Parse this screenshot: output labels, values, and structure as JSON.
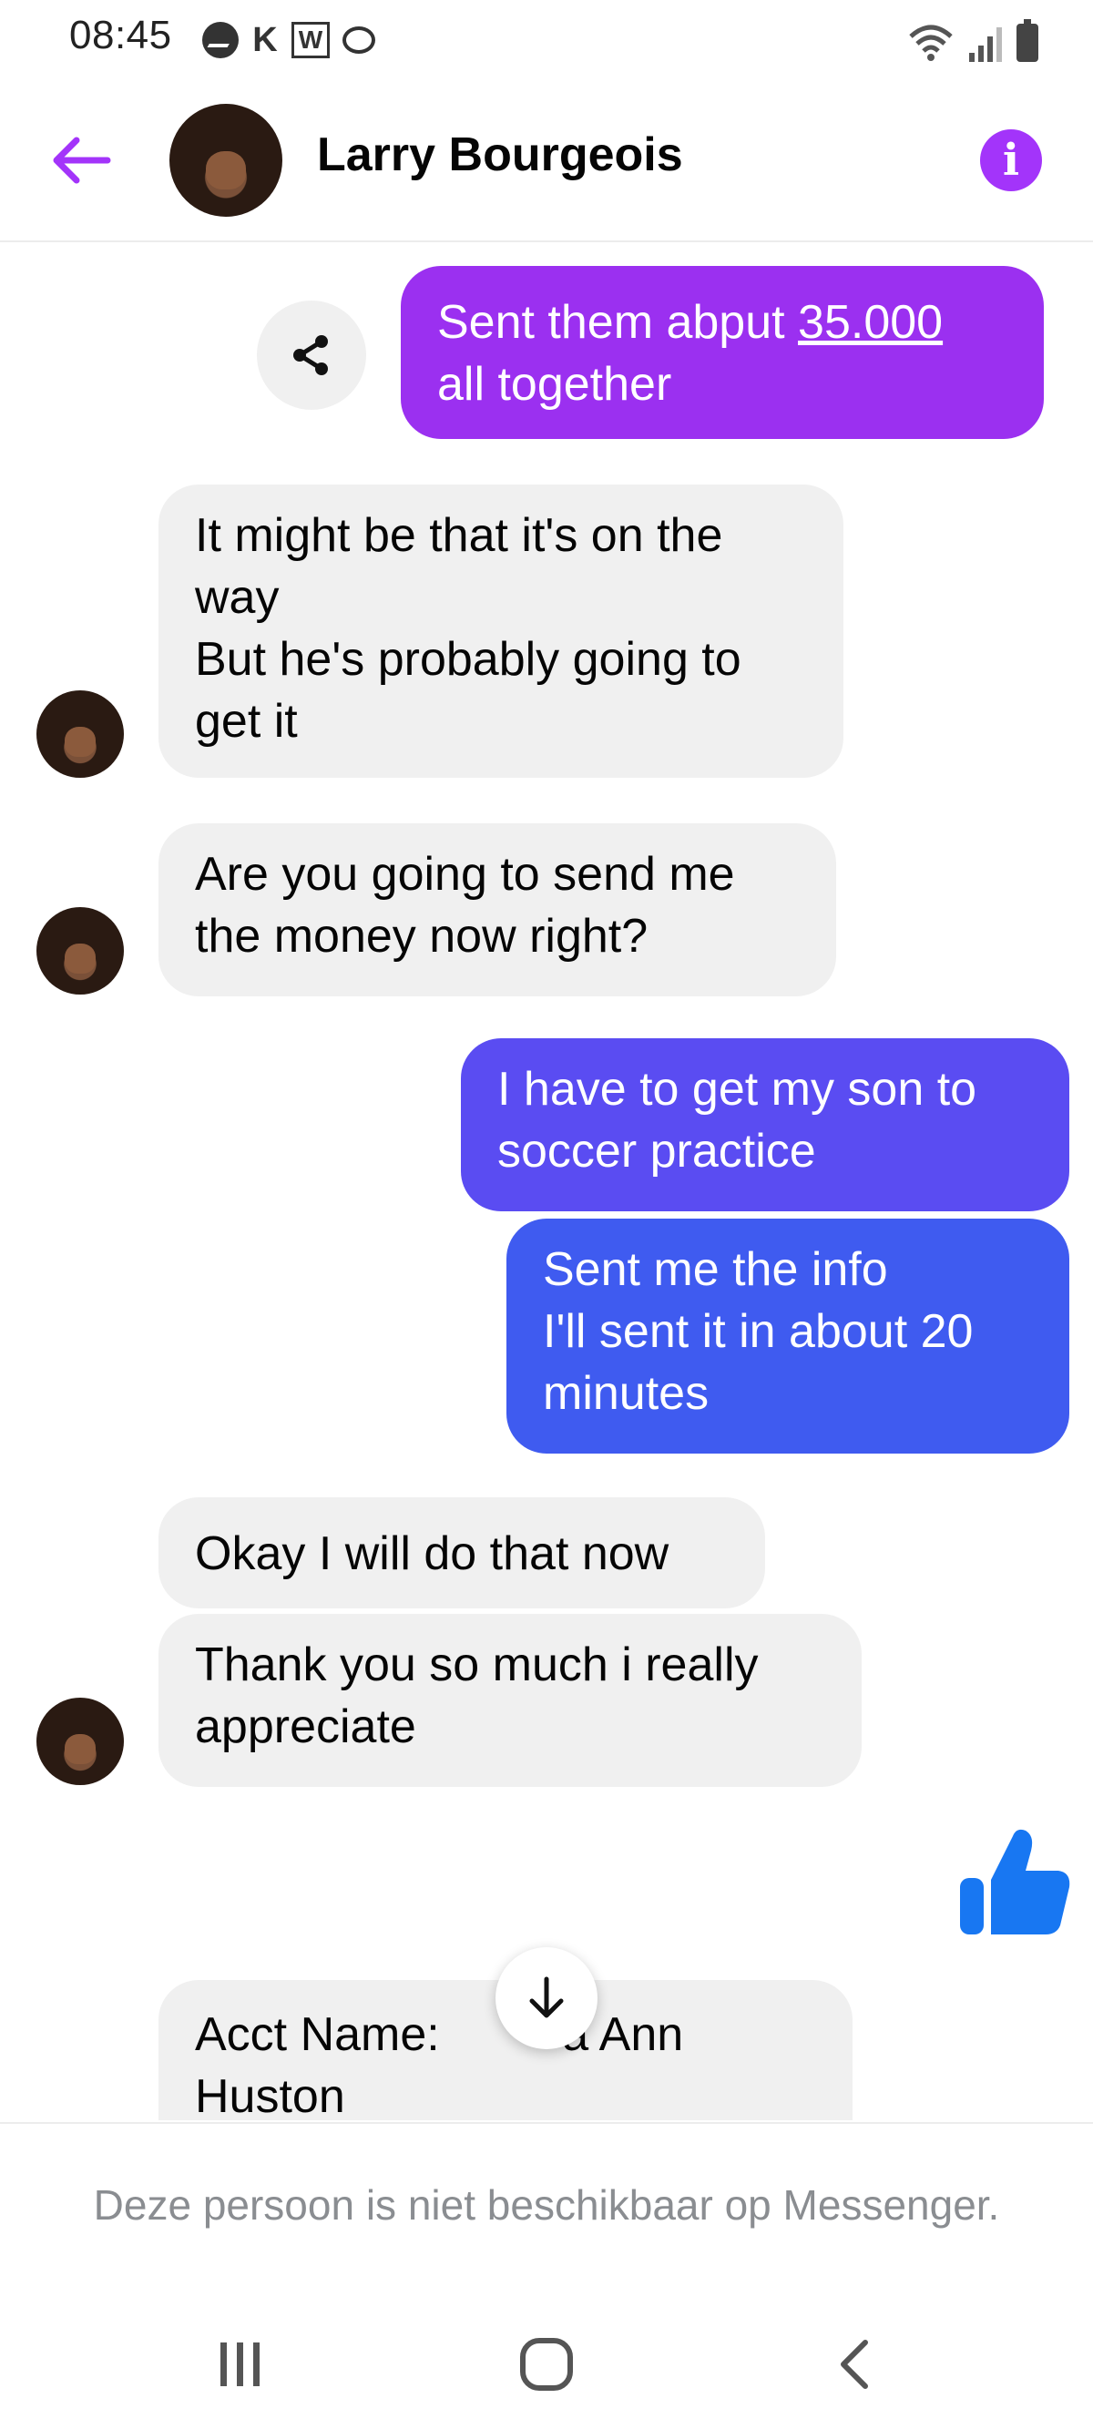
{
  "status_bar": {
    "time": "08:45",
    "notification_icons": [
      "messenger-icon",
      "k-icon",
      "w-icon",
      "chat-icon"
    ],
    "right_icons": [
      "wifi-icon",
      "signal-icon",
      "battery-icon"
    ],
    "k_label": "K",
    "w_label": "W"
  },
  "header": {
    "contact_name": "Larry Bourgeois",
    "info_label": "i",
    "accent_color": "#a334fa"
  },
  "messages": [
    {
      "id": "m1",
      "direction": "out",
      "text_prefix": "Sent them abput ",
      "text_link": "35.000",
      "text_suffix_line": "all together",
      "color": "#9b30f0"
    },
    {
      "id": "m2",
      "direction": "in",
      "lines": [
        "It might be that it's on the",
        "way",
        "But he's probably going to",
        "get it"
      ]
    },
    {
      "id": "m3",
      "direction": "in",
      "lines": [
        "Are you going to send me",
        "the money now right?"
      ]
    },
    {
      "id": "m4",
      "direction": "out",
      "lines": [
        "I have to get my son to",
        "soccer practice"
      ],
      "color": "#5a4cf2"
    },
    {
      "id": "m5",
      "direction": "out",
      "lines": [
        "Sent me the info",
        "I'll sent it in about 20",
        "minutes"
      ],
      "color": "#3f5bf0"
    },
    {
      "id": "m6",
      "direction": "in",
      "lines": [
        "Okay I will do that now"
      ]
    },
    {
      "id": "m7",
      "direction": "in",
      "lines": [
        "Thank you so much i really",
        "appreciate"
      ]
    },
    {
      "id": "m8",
      "direction": "in",
      "lines": [
        "Acct Name: ",
        "Huston"
      ],
      "line1_tail": "a Ann"
    }
  ],
  "like_color": "#1877f2",
  "footer": {
    "unavailable_text": "Deze persoon is niet beschikbaar op Messenger."
  },
  "navbar": {
    "buttons": [
      "recent-apps-icon",
      "home-icon",
      "back-nav-icon"
    ]
  }
}
